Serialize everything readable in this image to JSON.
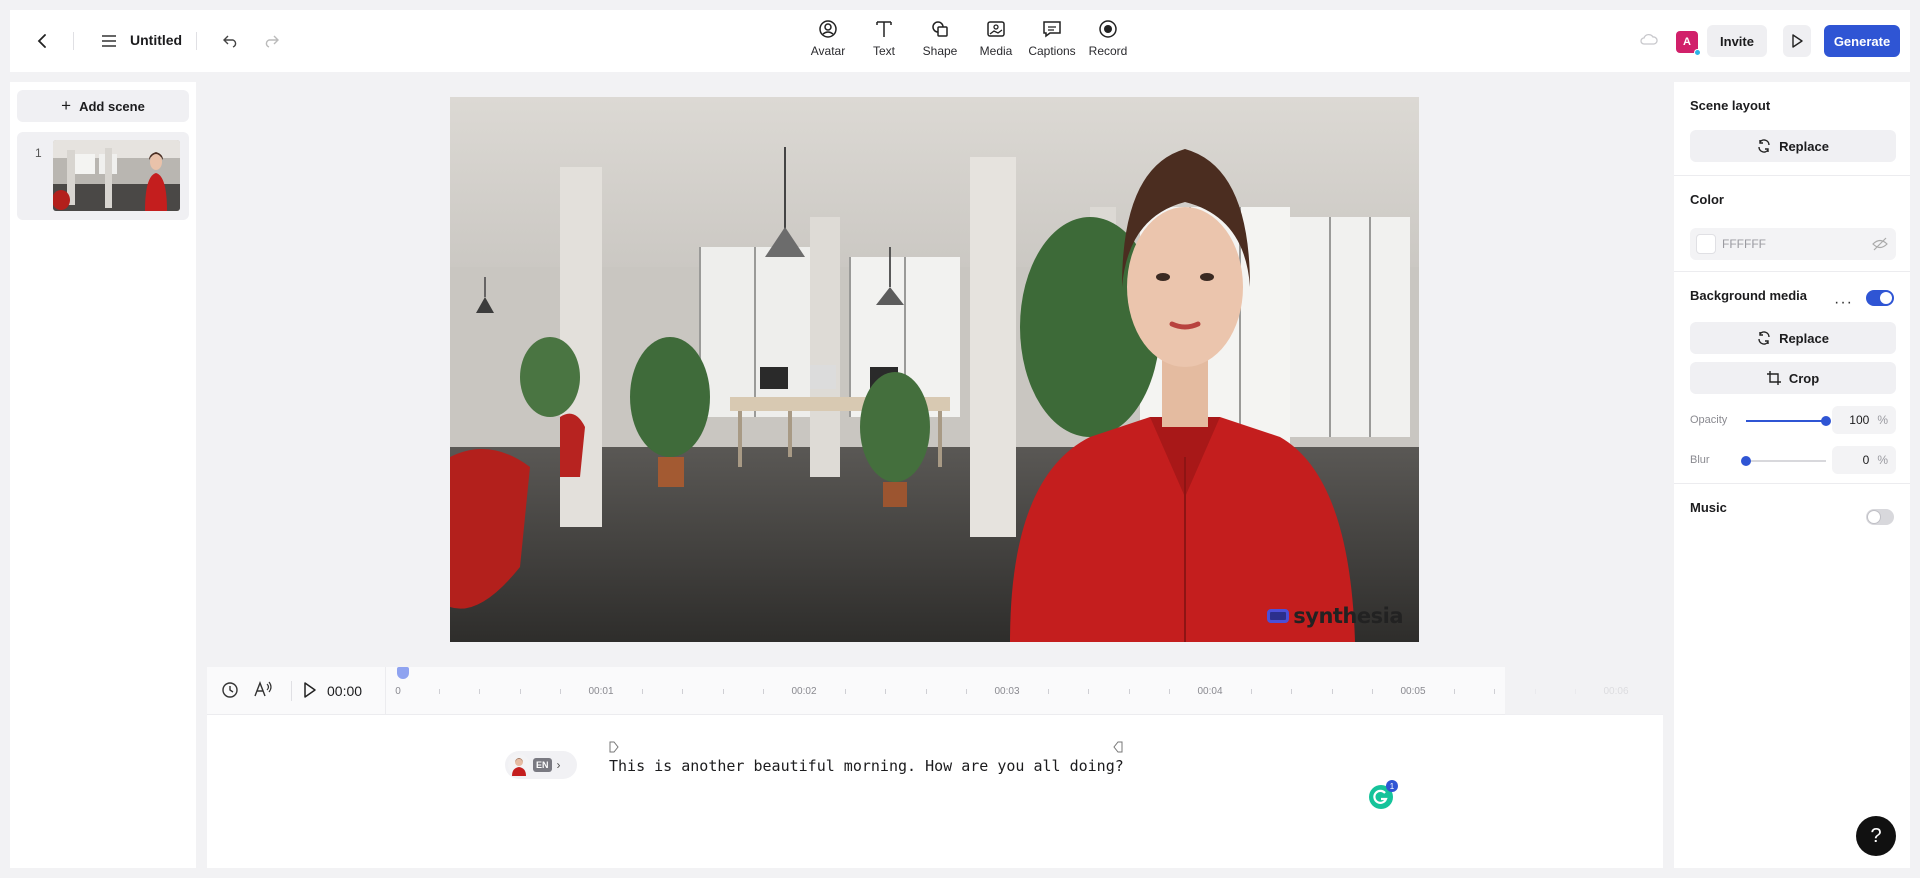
{
  "header": {
    "title": "Untitled",
    "tools": [
      {
        "label": "Avatar",
        "icon": "avatar-icon"
      },
      {
        "label": "Text",
        "icon": "text-icon"
      },
      {
        "label": "Shape",
        "icon": "shape-icon"
      },
      {
        "label": "Media",
        "icon": "media-icon"
      },
      {
        "label": "Captions",
        "icon": "captions-icon"
      },
      {
        "label": "Record",
        "icon": "record-icon"
      }
    ],
    "avatar_letter": "A",
    "invite_label": "Invite",
    "generate_label": "Generate",
    "accent_color": "#2f55d4",
    "avatar_color": "#d1206a"
  },
  "sidebar": {
    "add_scene_label": "Add scene",
    "scenes": [
      {
        "number": "1"
      }
    ]
  },
  "canvas": {
    "watermark": "synthesia"
  },
  "timeline": {
    "current_time": "00:00",
    "ticks": [
      "0",
      "00:01",
      "00:02",
      "00:03",
      "00:04",
      "00:05",
      "00:06"
    ],
    "voice_lang": "EN",
    "script": "This is another beautiful morning. How are you all doing?",
    "grammarly_count": "1"
  },
  "properties": {
    "scene_layout_title": "Scene layout",
    "replace_label": "Replace",
    "color_title": "Color",
    "color_value": "FFFFFF",
    "background_media_title": "Background media",
    "background_media_enabled": true,
    "crop_label": "Crop",
    "opacity_label": "Opacity",
    "opacity_value": "100",
    "opacity_fraction": 1.0,
    "blur_label": "Blur",
    "blur_value": "0",
    "blur_fraction": 0.0,
    "percent_sign": "%",
    "music_title": "Music",
    "music_enabled": false
  },
  "help_label": "?"
}
